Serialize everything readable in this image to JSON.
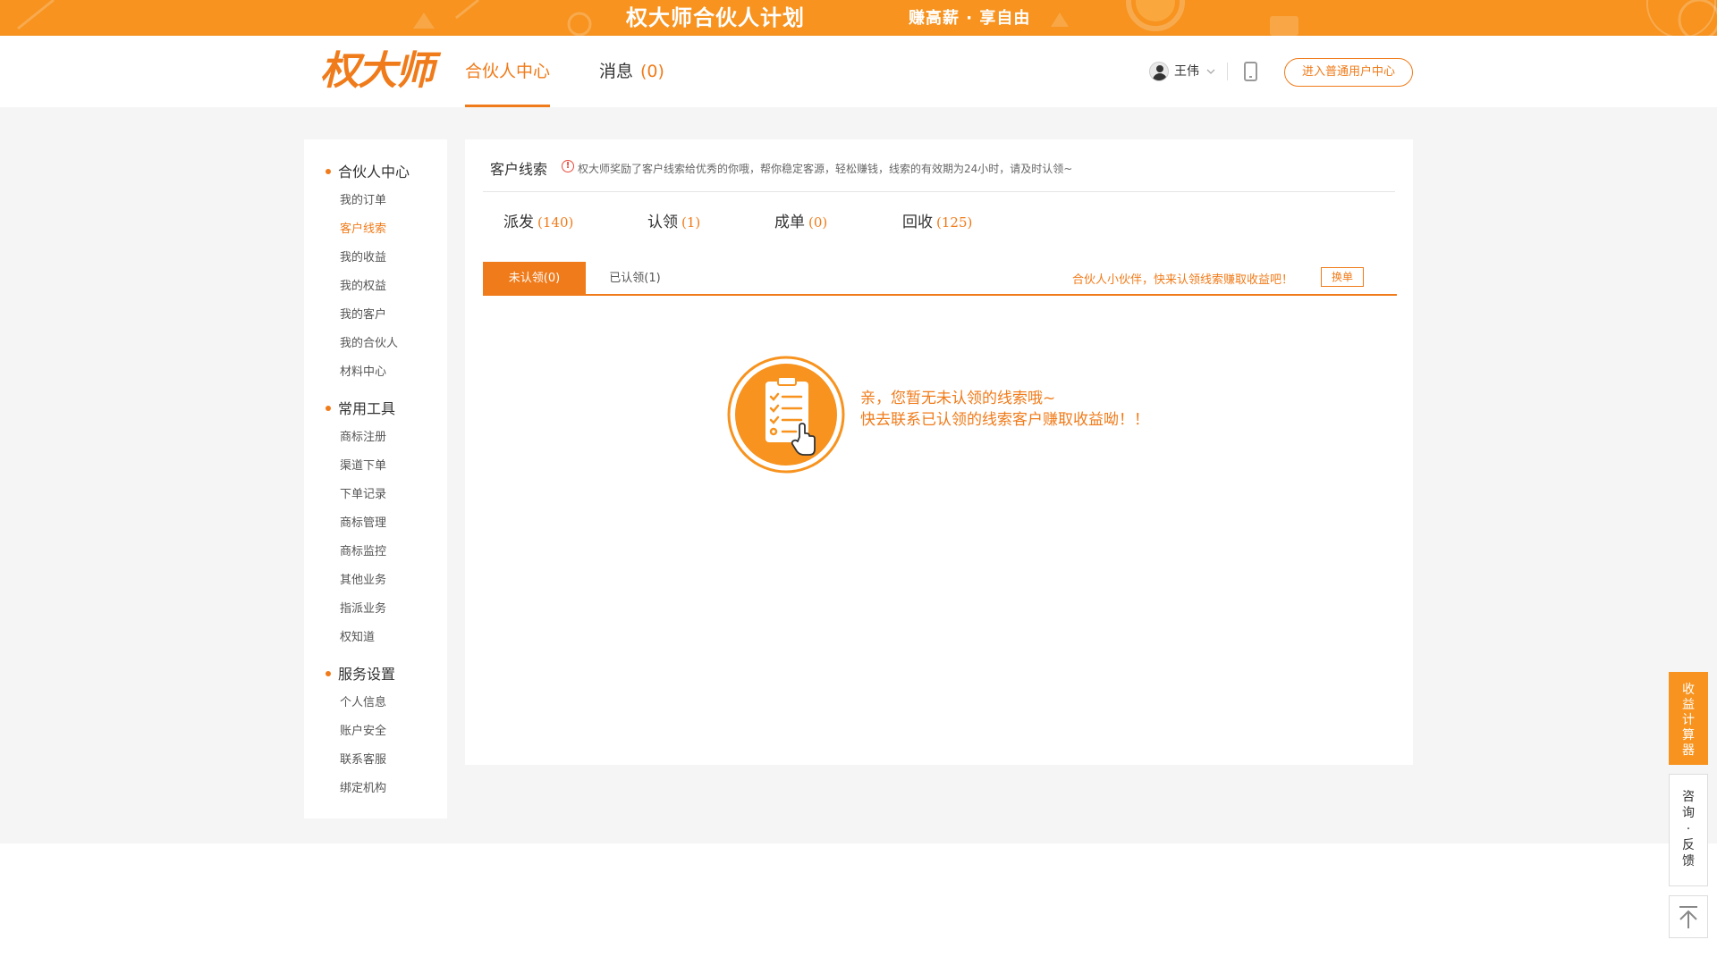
{
  "banner": {
    "title": "权大师合伙人计划",
    "slogan": "赚高薪 · 享自由",
    "bg_color": "#f7931e"
  },
  "header": {
    "logo_text": "权大师",
    "nav": [
      {
        "label": "合伙人中心",
        "active": true
      },
      {
        "label": "消息",
        "count": "(0)"
      }
    ],
    "user_name": "王伟",
    "user_icon": "avatar",
    "dropdown_icon": "chevron-down-icon",
    "mobile_icon": "mobile-phone-icon",
    "enter_button": "进入普通用户中心"
  },
  "sidebar": {
    "sections": [
      {
        "title": "合伙人中心",
        "items": [
          {
            "label": "我的订单"
          },
          {
            "label": "客户线索",
            "active": true
          },
          {
            "label": "我的收益"
          },
          {
            "label": "我的权益"
          },
          {
            "label": "我的客户"
          },
          {
            "label": "我的合伙人"
          },
          {
            "label": "材料中心"
          }
        ]
      },
      {
        "title": "常用工具",
        "items": [
          {
            "label": "商标注册"
          },
          {
            "label": "渠道下单"
          },
          {
            "label": "下单记录"
          },
          {
            "label": "商标管理"
          },
          {
            "label": "商标监控"
          },
          {
            "label": "其他业务"
          },
          {
            "label": "指派业务"
          },
          {
            "label": "权知道"
          }
        ]
      },
      {
        "title": "服务设置",
        "items": [
          {
            "label": "个人信息"
          },
          {
            "label": "账户安全"
          },
          {
            "label": "联系客服"
          },
          {
            "label": "绑定机构"
          }
        ]
      }
    ]
  },
  "main": {
    "title": "客户线索",
    "info_icon": "!",
    "tip": "权大师奖励了客户线索给优秀的你哦，帮你稳定客源，轻松赚钱，线索的有效期为24小时，请及时认领~",
    "stats": [
      {
        "label": "派发",
        "count": "(140)"
      },
      {
        "label": "认领",
        "count": "(1)"
      },
      {
        "label": "成单",
        "count": "(0)"
      },
      {
        "label": "回收",
        "count": "(125)"
      }
    ],
    "subtabs": [
      {
        "label": "未认领(0)",
        "active": true
      },
      {
        "label": "已认领(1)"
      }
    ],
    "promo": "合伙人小伙伴，快来认领线索赚取收益吧！",
    "switch_button": "换单",
    "empty": {
      "line1": "亲，您暂无未认领的线索哦~",
      "line2": "快去联系已认领的线索客户赚取收益呦！！",
      "icon": "clipboard-checklist-icon"
    }
  },
  "floating": {
    "calculator": [
      "收",
      "益",
      "计",
      "算",
      "器"
    ],
    "consult": [
      "咨",
      "询",
      "·",
      "反",
      "馈"
    ],
    "back_top_icon": "back-to-top-icon"
  },
  "colors": {
    "accent": "#f07b1a",
    "banner": "#f7931e",
    "page_bg": "#f5f5f5"
  }
}
